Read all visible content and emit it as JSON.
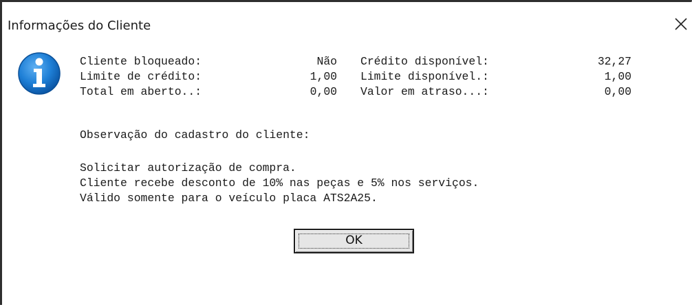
{
  "window": {
    "title": "Informações do Cliente",
    "close_icon": "close-icon"
  },
  "icon": {
    "name": "information-icon",
    "color": "#1e7fd6",
    "glyph": "i"
  },
  "stats": [
    {
      "label1": "Cliente bloqueado:",
      "value1": "Não",
      "label2": "Crédito disponível:",
      "value2": "32,27"
    },
    {
      "label1": "Limite de crédito:",
      "value1": "1,00",
      "label2": "Limite disponível.:",
      "value2": "1,00"
    },
    {
      "label1": "Total em aberto..:",
      "value1": "0,00",
      "label2": "Valor em atraso...:",
      "value2": "0,00"
    }
  ],
  "observation": {
    "title": "Observação do cadastro do cliente:",
    "lines": [
      "Solicitar autorização de compra.",
      "Cliente recebe desconto de 10% nas peças e 5% nos serviços.",
      "Válido somente para o veículo placa ATS2A25."
    ]
  },
  "buttons": {
    "ok_label": "OK"
  }
}
